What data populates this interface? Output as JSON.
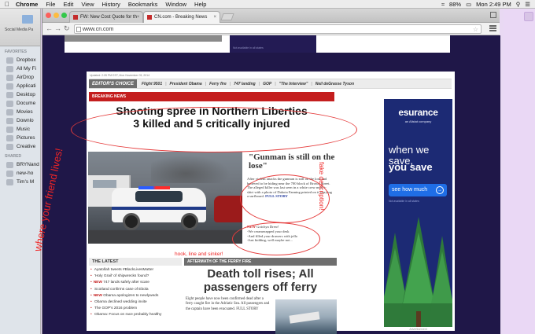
{
  "menubar": {
    "app": "Chrome",
    "menus": [
      "File",
      "Edit",
      "View",
      "History",
      "Bookmarks",
      "Window",
      "Help"
    ],
    "battery": "88%",
    "clock": "Mon 2:49 PM"
  },
  "finder": {
    "sub_label": "Social Media Pa",
    "favorites_label": "FAVORITES",
    "favorites": [
      "Dropbox",
      "All My Fi",
      "AirDrop",
      "Applicati",
      "Desktop",
      "Docume",
      "Movies",
      "Downlo",
      "Music",
      "Pictures",
      "Creative"
    ],
    "shared_label": "SHARED",
    "shared": [
      "BRYNand",
      "new-ho",
      "Tim's M"
    ]
  },
  "browser": {
    "tabs": [
      {
        "title": "FW: New Cost Quote for th"
      },
      {
        "title": "CN.com - Breaking News"
      }
    ],
    "url": "www.cn.com"
  },
  "page": {
    "updated": "Updated: 2:05 PM EST, Mon November 03, 2014",
    "editors_choice": {
      "label": "EDITOR'S CHOICE",
      "items": [
        "Flight 9501",
        "President Obama",
        "Ferry fire",
        "747 landing",
        "GOP",
        "\"The Interview\"",
        "Neil deGrasse Tyson"
      ]
    },
    "breaking": {
      "label": "BREAKING NEWS",
      "headline_line1": "Shooting spree in Northern Liberties",
      "headline_line2": "3 killed and 5 critically injured"
    },
    "quote": "\"Gunman is still on the lose\"",
    "story": {
      "text": "After violent attacks the gunman is still on the lose and believed to be hiding near the 700 block of Brown Street. The alleged killer was last seen in a white crew neck t-shirt with a photo of Dakota Fanning printed on it carrying a surfboard.",
      "link": "FULL STORY"
    },
    "new_block": {
      "new_label": "NEW",
      "title": "Gotchya Drew!",
      "lines": [
        "-We ceramerapped your desk",
        "-And filled your drawers with jello",
        "-Just kidding, well maybe not..."
      ]
    },
    "latest": {
      "label": "THE LATEST",
      "items": [
        {
          "new": "",
          "text": "Ayatollah tweets #BlackLivesMatter"
        },
        {
          "new": "",
          "text": "'Holy Grail' of shipwrecks found?"
        },
        {
          "new": "NEW",
          "text": "747 lands safely after scare"
        },
        {
          "new": "",
          "text": "Scotland confirms case of Ebola"
        },
        {
          "new": "NEW",
          "text": "Obama apologizes to newlyweds"
        },
        {
          "new": "",
          "text": "Obama declined wedding invite"
        },
        {
          "new": "",
          "text": "The GOP's 2016 problem"
        },
        {
          "new": "",
          "text": "Obama: Focus on race probably healthy"
        }
      ]
    },
    "ferry": {
      "label": "AFTERMATH OF THE FERRY FIRE",
      "headline": "Death toll rises; All passengers off ferry",
      "body": "Eight people have now been confirmed dead after a ferry caught fire in the Adriatic Sea. All passengers and the captain have been evacuated.",
      "link": "FULL STORY"
    },
    "ad": {
      "brand": "esurance",
      "sub": "an Allstat company",
      "line1": "when we save,",
      "line2": "you save",
      "button": "see how much",
      "note": "Not available in all states",
      "footer": "Advertisement",
      "top_note": "Not available in all states"
    }
  },
  "annotations": {
    "left": "where your friend lives!",
    "fake": "fake description!",
    "hook": "hook, line and sinker!"
  },
  "colors": {
    "breaking_red": "#c41e1e",
    "annotation_red": "#ef2525",
    "ad_blue": "#1c2a74",
    "page_bg": "#1f1748"
  }
}
